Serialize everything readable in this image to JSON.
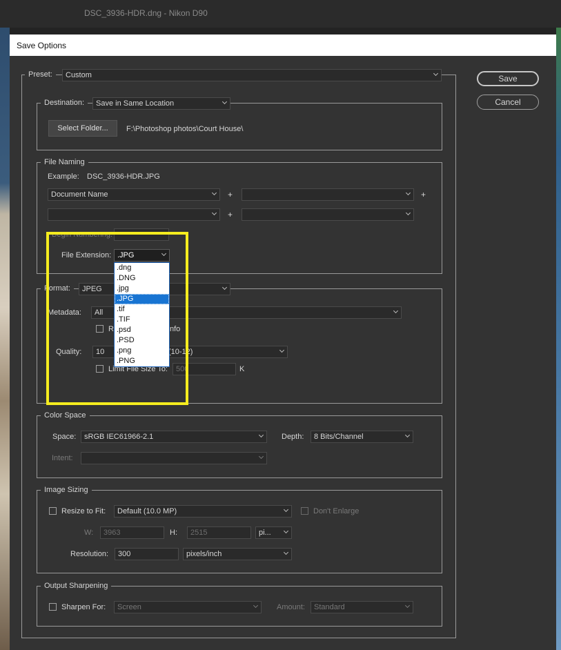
{
  "app": {
    "title": "DSC_3936-HDR.dng  -  Nikon D90"
  },
  "dialog": {
    "title": "Save Options",
    "save_label": "Save",
    "cancel_label": "Cancel"
  },
  "preset": {
    "label": "Preset:",
    "value": "Custom"
  },
  "destination": {
    "label": "Destination:",
    "value": "Save in Same Location",
    "select_folder_label": "Select Folder...",
    "path": "F:\\Photoshop photos\\Court House\\"
  },
  "file_naming": {
    "legend": "File Naming",
    "example_label": "Example:",
    "example_value": "DSC_3936-HDR.JPG",
    "field1": "Document Name",
    "field2": "",
    "field3": "",
    "field4": "",
    "plus": "+",
    "begin_numbering_label": "Begin Numbering:",
    "file_extension_label": "File Extension:",
    "file_extension_value": ".JPG",
    "extension_options": [
      ".dng",
      ".DNG",
      ".jpg",
      ".JPG",
      ".tif",
      ".TIF",
      ".psd",
      ".PSD",
      ".png",
      ".PNG"
    ],
    "selected_extension": ".JPG"
  },
  "format": {
    "label": "Format:",
    "value": "JPEG",
    "metadata_label": "Metadata:",
    "metadata_value": "All",
    "remove_info_partial_a": "Re",
    "remove_info_partial_b": "nfo",
    "quality_label": "Quality:",
    "quality_value": "10",
    "quality_range_partial": "(10-12)",
    "limit_label": "Limit File Size To:",
    "limit_value": "500",
    "limit_unit": "K"
  },
  "color_space": {
    "legend": "Color Space",
    "space_label": "Space:",
    "space_value": "sRGB IEC61966-2.1",
    "depth_label": "Depth:",
    "depth_value": "8 Bits/Channel",
    "intent_label": "Intent:",
    "intent_value": ""
  },
  "image_sizing": {
    "legend": "Image Sizing",
    "resize_label": "Resize to Fit:",
    "resize_value": "Default  (10.0 MP)",
    "dont_enlarge_label": "Don't Enlarge",
    "w_label": "W:",
    "w_value": "3963",
    "h_label": "H:",
    "h_value": "2515",
    "unit_value": "pi...",
    "resolution_label": "Resolution:",
    "resolution_value": "300",
    "resolution_unit": "pixels/inch"
  },
  "output_sharpening": {
    "legend": "Output Sharpening",
    "sharpen_label": "Sharpen For:",
    "sharpen_value": "Screen",
    "amount_label": "Amount:",
    "amount_value": "Standard"
  },
  "colors": {
    "dialog_bg": "#333333",
    "highlight": "#f5ec1f",
    "selection": "#1874d2"
  }
}
